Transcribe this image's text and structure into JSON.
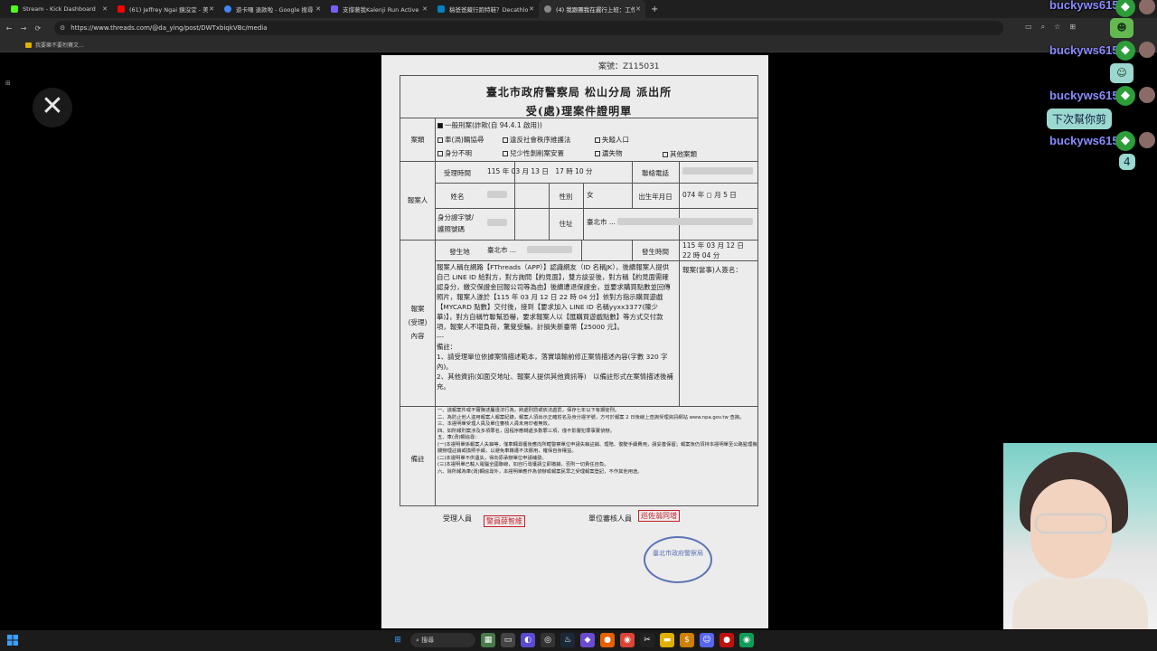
{
  "browser": {
    "tabs": [
      {
        "title": "Stream - Kick Dashboard",
        "color": "#53fc18"
      },
      {
        "title": "(61) Jeffrey Ngai 鏡沒堂 - 美洲",
        "color": "#ff0000"
      },
      {
        "title": "遊卡囉 退款啦 - Google 搜尋",
        "color": "#4285f4"
      },
      {
        "title": "支撐著我Kalenji Run Active -",
        "color": "#7a5cff"
      },
      {
        "title": "稿爸爸藏行跑特鞋？Decathlon",
        "color": "#0082c3"
      },
      {
        "title": "(4) 我跟團我在遲行上班：工作",
        "color": "#888888"
      }
    ],
    "url": "https://www.threads.com/@da_ying/post/DWTxbiqkVBc/media",
    "bookmark": "我要樂不要烈賽文..."
  },
  "doc": {
    "case_no": "案號：Z115031",
    "title1": "臺北市政府警察局 松山分局 派出所",
    "title2": "受(處)理案件證明單",
    "category_label": "案類",
    "opt_fraud": "一般刑案(詐欺(自 94.4.1 啟用))",
    "opt_traffic": "車(渦)輛協尋",
    "opt_order": "違反社會秩序維護法",
    "opt_missing": "失蹤人口",
    "opt_unknown": "身分不明",
    "opt_child": "兒少性剝削案安置",
    "opt_lost": "遺失物",
    "opt_other": "其他案類",
    "reporter_label": "報案人",
    "accept_time_label": "受理時間",
    "accept_time": "115 年 03 月 13 日　17 時 10 分",
    "phone_label": "聯絡電話",
    "name_label": "姓名",
    "gender_label": "性別",
    "gender": "女",
    "birth_label": "出生年月日",
    "birth": "074 年 ◻ 月 5 日",
    "id_label": "身分證字號/\n護照號碼",
    "addr_label": "住址",
    "addr": "臺北市 ...",
    "place_label": "發生地",
    "place": "臺北市 ...",
    "occur_time_label": "發生時間",
    "occur_time": "115 年 03 月 12 日\n22 時 04 分",
    "content_label": "報案\n(受理)\n內容",
    "signature_label": "報案(當事)人簽名：",
    "story": "報案人稱在網路【FThreads（APP）】認識網友（ID 名稱JK），後續報案人提供自己 LINE ID 給對方，對方詢問【約見面】，雙方談妥後，對方稱【約見面需確認身分，繳交保證金回報公司等為由】後續遭退保證金，並要求購買點數並回傳照片，報案人遂於【115 年 03 月 12 日 22 時 04 分】依對方指示購買遊戲【MYCARD 點數】交付後，接到【要求加入 LINE ID 名稱yyxx3377(陳少華)】，對方自稱竹聯幫恐嚇，要求報案人以【匯購買遊戲點數】等方式交付款項，報案人不堪負荷，驚覺受騙，計損失新臺幣【25000 元】。\n---\n備註：\n1、請受理單位依據案情描述範本，落實填輸前修正案情描述內容(字數 320 字內)。\n2、其他資訊(如面交地址、報案人提供其他資訊等)　以備註形式在案情描述後補充。",
    "remark_label": "備註",
    "notes": [
      "一、謊報案件或不實陳述屬違法行為，將處刑罰或依法處罰，保存七年以下有期徒刑。",
      "二、為防止他人盜用報案人報案紀錄，報案人須出示正確姓名及身分證字號，方可於報案 2 日後線上查詢受理資訊網站 www.npa.gov.tw 查詢。",
      "三、本證明單受理人員及單位審核人員未用印者無效。",
      "四、如所報刑案涉及多項罪名，因程序應轉處多數罪三項，僅不影響犯罪事實偵辦。",
      "五、車(渦)輛協尋：",
      "(一)本證明單係報案人失竊等，僅車輛尋獲後應向所轄警察單位申請失竊註銷、理賠、復駛手續費用，請妥善保留；報案後仍須持本證明單至公路監理機關辦理註銷或換照手續，以避免車籍遭不法挪用，確保自身權益。",
      "(二)本證明單不供遺失，得向原承辦單位申請補發。",
      "(三)本證明單已輸入電腦全國聯線，如自行尋獲請立即撤銷，否則一切責任自負。",
      "六、除所報為車(渦)輛協尋外，本證明單應作為偵辦或報案民眾之受理報案登記，不作其他用途。"
    ],
    "officer_label": "受理人員",
    "officer_stamp": "警員薛智維",
    "reviewer_label": "單位審核人員",
    "reviewer_stamp": "巡佐翁同增",
    "seal_text": "臺北市政府警察局"
  },
  "chat": {
    "user": "buckyws615",
    "bubble": "下次幫你剪",
    "count": "4"
  },
  "taskbar": {
    "search": "搜尋"
  }
}
